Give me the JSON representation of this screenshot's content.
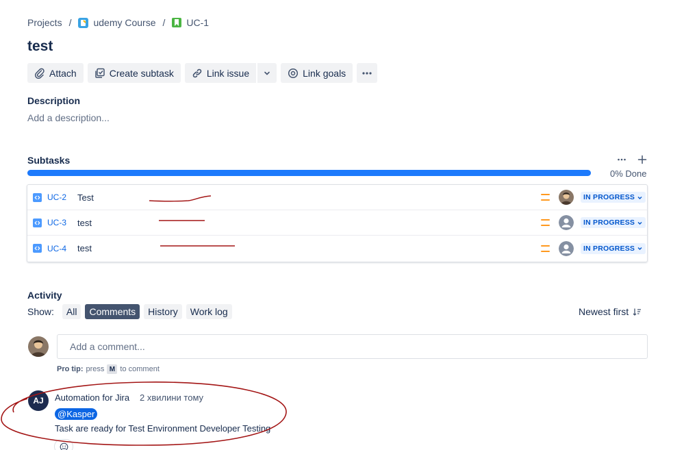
{
  "breadcrumb": {
    "items": [
      {
        "label": "Projects"
      },
      {
        "label": "udemy Course"
      },
      {
        "label": "UC-1"
      }
    ],
    "separator": "/"
  },
  "issue": {
    "title": "test"
  },
  "toolbar": {
    "attach_label": "Attach",
    "create_subtask_label": "Create subtask",
    "link_issue_label": "Link issue",
    "link_goals_label": "Link goals"
  },
  "description": {
    "heading": "Description",
    "placeholder": "Add a description..."
  },
  "subtasks": {
    "heading": "Subtasks",
    "progress_percent": 100,
    "progress_text": "0% Done",
    "items": [
      {
        "key": "UC-2",
        "summary": "Test",
        "status": "IN PROGRESS",
        "priority": "medium",
        "assignee": "photo"
      },
      {
        "key": "UC-3",
        "summary": "test",
        "status": "IN PROGRESS",
        "priority": "medium",
        "assignee": "unassigned"
      },
      {
        "key": "UC-4",
        "summary": "test",
        "status": "IN PROGRESS",
        "priority": "medium",
        "assignee": "unassigned"
      }
    ]
  },
  "activity": {
    "heading": "Activity",
    "show_label": "Show:",
    "filters": [
      {
        "label": "All",
        "active": false
      },
      {
        "label": "Comments",
        "active": true
      },
      {
        "label": "History",
        "active": false
      },
      {
        "label": "Work log",
        "active": false
      }
    ],
    "sort_label": "Newest first",
    "comment_placeholder": "Add a comment...",
    "protip": {
      "prefix": "Pro tip:",
      "press": "press",
      "key": "M",
      "suffix": "to comment"
    }
  },
  "comment": {
    "avatar_initials": "AJ",
    "author": "Automation for Jira",
    "time": "2 хвилини тому",
    "mention": "@Kasper",
    "body": "Task are ready for Test Environment Developer Testing"
  },
  "colors": {
    "accent": "#0c66e4",
    "progress": "#1d7afc",
    "status_bg": "#e9f2ff",
    "status_text": "#0055cc",
    "priority_medium": "#ff991f",
    "annotation_red": "#a31515"
  }
}
